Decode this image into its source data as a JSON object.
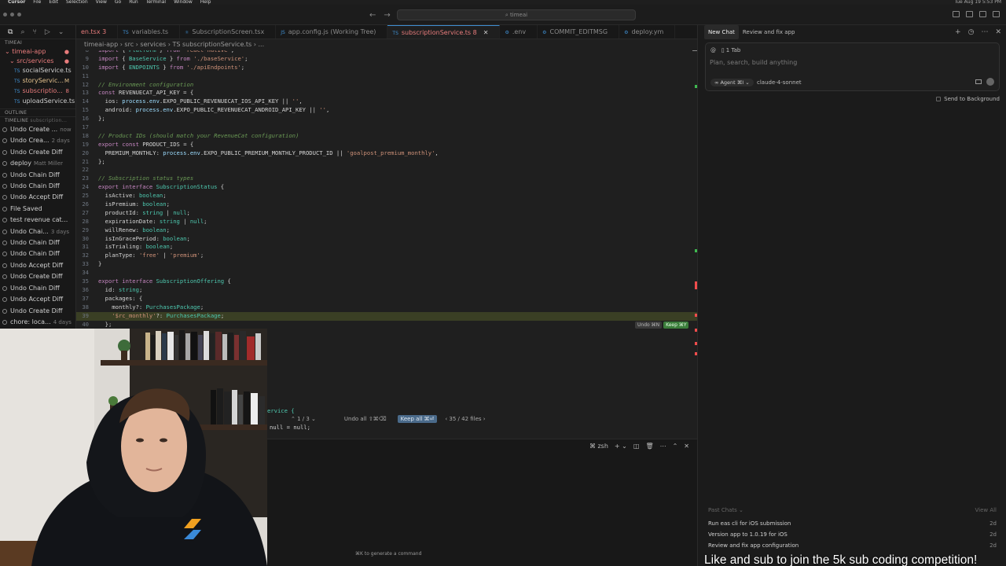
{
  "menubar": {
    "items": [
      "Cursor",
      "File",
      "Edit",
      "Selection",
      "View",
      "Go",
      "Run",
      "Terminal",
      "Window",
      "Help"
    ],
    "clock": "Tue Aug 19 5:53 PM"
  },
  "titlebar": {
    "search": "timeai"
  },
  "sidebar": {
    "root": "TIMEAI",
    "project": "timeai-app",
    "folder": "src/services",
    "files": [
      {
        "name": "socialService.ts",
        "badge": ""
      },
      {
        "name": "storyServic...",
        "badge": "M"
      },
      {
        "name": "subscriptio...",
        "badge": "8"
      },
      {
        "name": "uploadService.ts",
        "badge": ""
      }
    ],
    "outline": "OUTLINE",
    "timeline": "TIMELINE",
    "timeline_file": "subscription...",
    "timeline_items": [
      {
        "label": "Undo Create ...",
        "meta": "now"
      },
      {
        "label": "Undo Crea...",
        "meta": "2 days"
      },
      {
        "label": "Undo Create Diff",
        "meta": ""
      },
      {
        "label": "deploy",
        "meta": "Matt Miller"
      },
      {
        "label": "Undo Chain Diff",
        "meta": ""
      },
      {
        "label": "Undo Chain Diff",
        "meta": ""
      },
      {
        "label": "Undo Accept Diff",
        "meta": ""
      },
      {
        "label": "File Saved",
        "meta": ""
      },
      {
        "label": "test revenue cat...",
        "meta": ""
      },
      {
        "label": "Undo Chai...",
        "meta": "3 days"
      },
      {
        "label": "Undo Chain Diff",
        "meta": ""
      },
      {
        "label": "Undo Chain Diff",
        "meta": ""
      },
      {
        "label": "Undo Accept Diff",
        "meta": ""
      },
      {
        "label": "Undo Create Diff",
        "meta": ""
      },
      {
        "label": "Undo Chain Diff",
        "meta": ""
      },
      {
        "label": "Undo Accept Diff",
        "meta": ""
      },
      {
        "label": "Undo Create Diff",
        "meta": ""
      },
      {
        "label": "chore: loca...",
        "meta": "4 days"
      },
      {
        "label": "Undo Chain Diff",
        "meta": ""
      }
    ]
  },
  "tabs": [
    {
      "label": "en.tsx 3",
      "icon": "",
      "state": "red"
    },
    {
      "label": "variables.ts",
      "icon": "TS",
      "state": ""
    },
    {
      "label": "SubscriptionScreen.tsx",
      "icon": "⚛",
      "state": ""
    },
    {
      "label": "app.config.js (Working Tree)",
      "icon": "JS",
      "state": ""
    },
    {
      "label": "subscriptionService.ts 8",
      "icon": "TS",
      "state": "active"
    },
    {
      "label": ".env",
      "icon": "⚙",
      "state": ""
    },
    {
      "label": "COMMIT_EDITMSG",
      "icon": "⚙",
      "state": ""
    },
    {
      "label": "deploy.ym",
      "icon": "⚙",
      "state": ""
    }
  ],
  "breadcrumb": "timeai-app  ›  src  ›  services  ›  TS subscriptionService.ts  ›  ...",
  "code": [
    {
      "n": "8",
      "t": "import { Platform } from 'react-native';"
    },
    {
      "n": "9",
      "t": "import { BaseService } from './baseService';"
    },
    {
      "n": "10",
      "t": "import { ENDPOINTS } from './apiEndpoints';"
    },
    {
      "n": "11",
      "t": ""
    },
    {
      "n": "12",
      "t": "// Environment configuration"
    },
    {
      "n": "13",
      "t": "const REVENUECAT_API_KEY = {"
    },
    {
      "n": "14",
      "t": "  ios: process.env.EXPO_PUBLIC_REVENUECAT_IOS_API_KEY || '',"
    },
    {
      "n": "15",
      "t": "  android: process.env.EXPO_PUBLIC_REVENUECAT_ANDROID_API_KEY || '',"
    },
    {
      "n": "16",
      "t": "};"
    },
    {
      "n": "17",
      "t": ""
    },
    {
      "n": "18",
      "t": "// Product IDs (should match your RevenueCat configuration)"
    },
    {
      "n": "19",
      "t": "export const PRODUCT_IDS = {"
    },
    {
      "n": "20",
      "t": "  PREMIUM_MONTHLY: process.env.EXPO_PUBLIC_PREMIUM_MONTHLY_PRODUCT_ID || 'goalpost_premium_monthly',"
    },
    {
      "n": "21",
      "t": "};"
    },
    {
      "n": "22",
      "t": ""
    },
    {
      "n": "23",
      "t": "// Subscription status types"
    },
    {
      "n": "24",
      "t": "export interface SubscriptionStatus {"
    },
    {
      "n": "25",
      "t": "  isActive: boolean;"
    },
    {
      "n": "26",
      "t": "  isPremium: boolean;"
    },
    {
      "n": "27",
      "t": "  productId: string | null;"
    },
    {
      "n": "28",
      "t": "  expirationDate: string | null;"
    },
    {
      "n": "29",
      "t": "  willRenew: boolean;"
    },
    {
      "n": "30",
      "t": "  isInGracePeriod: boolean;"
    },
    {
      "n": "31",
      "t": "  isTrialing: boolean;"
    },
    {
      "n": "32",
      "t": "  planType: 'free' | 'premium';"
    },
    {
      "n": "33",
      "t": "}"
    },
    {
      "n": "34",
      "t": ""
    },
    {
      "n": "35",
      "t": "export interface SubscriptionOffering {"
    },
    {
      "n": "36",
      "t": "  id: string;"
    },
    {
      "n": "37",
      "t": "  packages: {"
    },
    {
      "n": "38",
      "t": "    monthly?: PurchasesPackage;"
    },
    {
      "n": "39",
      "t": "    '$rc_monthly'?: PurchasesPackage;"
    },
    {
      "n": "40",
      "t": "  };"
    }
  ],
  "inline_actions": {
    "undo": "Undo ⌘N",
    "keep": "Keep ⌘Y"
  },
  "lower_code": {
    "line1": "ervice {",
    "line2": "null = null;"
  },
  "diffbar": {
    "nav": "⌃  1 / 3  ⌄",
    "undo_all": "Undo all ⇧⌘⌫",
    "keep_all": "Keep all ⌘⏎",
    "files": "‹  35 / 42 files  ›"
  },
  "terminal": {
    "shell": "zsh",
    "hint": "⌘K to generate a command"
  },
  "chat": {
    "tabs": [
      "New Chat",
      "Review and fix app"
    ],
    "context": "1 Tab",
    "placeholder": "Plan, search, build anything",
    "agent": "∞ Agent ⌘I  ⌄",
    "model": "claude-4-sonnet",
    "send_background": "Send to Background",
    "past_chats": "Past Chats  ⌄",
    "view_all": "View All",
    "history": [
      {
        "title": "Run eas cli for iOS submission",
        "age": "2d"
      },
      {
        "title": "Version app to 1.0.19 for iOS",
        "age": "2d"
      },
      {
        "title": "Review and fix app configuration",
        "age": "2d"
      }
    ]
  },
  "caption": "Like and sub to join the 5k sub coding competition!",
  "colors": {
    "keyword": "#c586c0",
    "string": "#ce9178",
    "type": "#4ec9b0",
    "comment": "#6a9955",
    "accent": "#3f8fd2"
  }
}
